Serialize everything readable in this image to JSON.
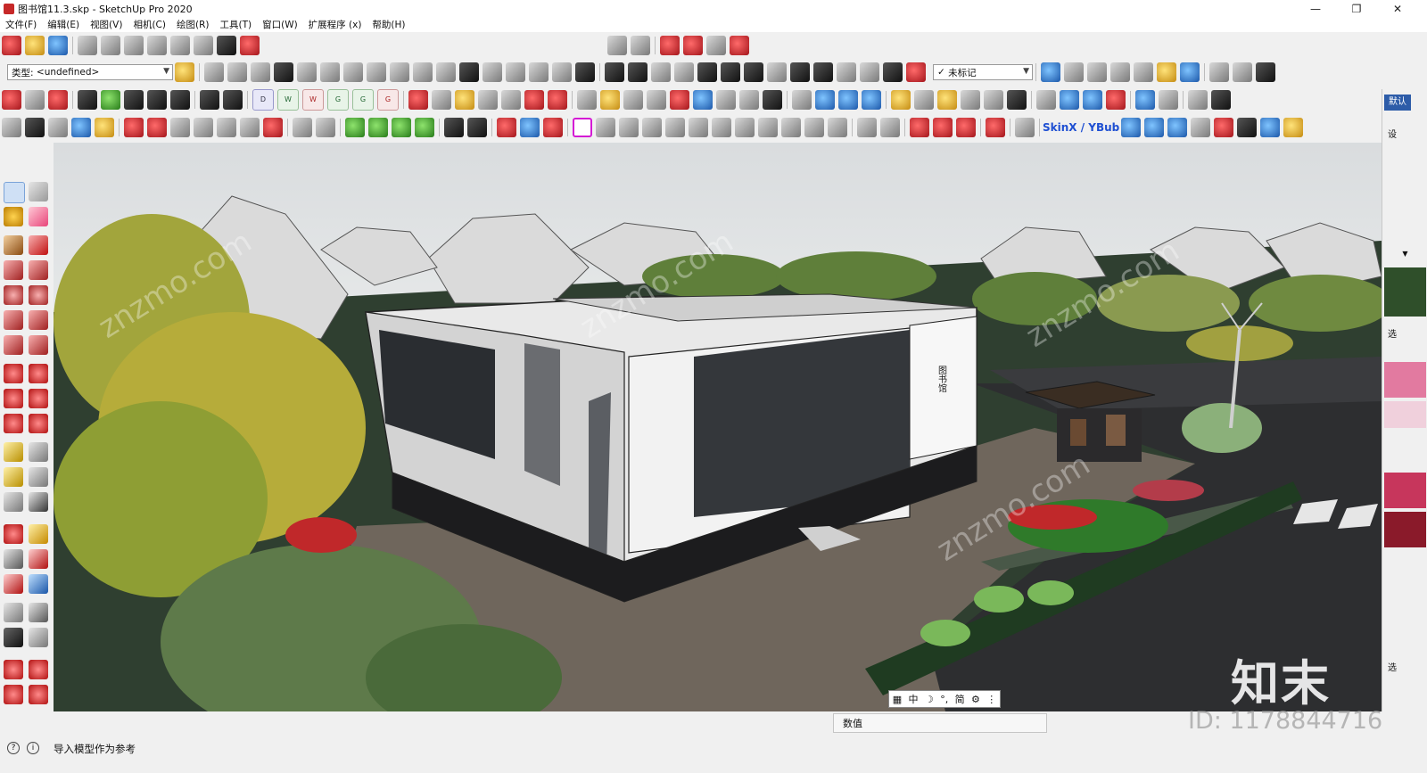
{
  "window": {
    "title": "图书馆11.3.skp - SketchUp Pro 2020",
    "minimize": "—",
    "restore": "❐",
    "close": "✕"
  },
  "menu": [
    "文件(F)",
    "编辑(E)",
    "视图(V)",
    "相机(C)",
    "绘图(R)",
    "工具(T)",
    "窗口(W)",
    "扩展程序 (x)",
    "帮助(H)"
  ],
  "toolbar": {
    "type_label": "类型:",
    "type_value": "<undefined>",
    "tag_value": "未标记",
    "tag_check": "✓",
    "skin_label": "SkinX / YBub",
    "letters": [
      "D",
      "W",
      "W",
      "G",
      "G",
      "G"
    ]
  },
  "ime": {
    "items": [
      "中",
      "简"
    ]
  },
  "status": {
    "measure_label": "数值",
    "hint": "导入模型作为参考",
    "info_icon": "i",
    "help_icon": "?"
  },
  "right_panel": {
    "labels": [
      "默认",
      "设",
      "选",
      "选"
    ]
  },
  "watermark": {
    "logo": "知末",
    "id": "ID: 1178844716",
    "diagonal": "znzmo.com"
  },
  "building_sign": "图书馆"
}
